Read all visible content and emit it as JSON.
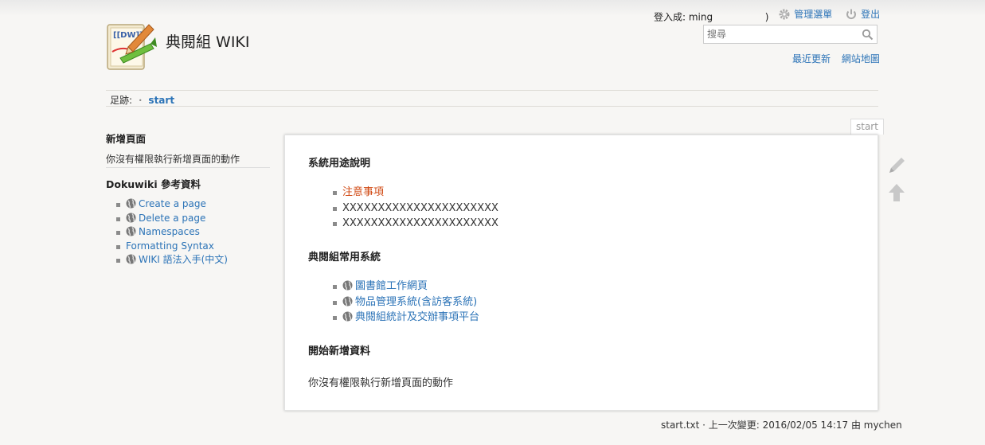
{
  "header": {
    "wiki_title": "典閱組 WIKI",
    "logo_text": "[[DW]]",
    "user_tools": {
      "logged_in_as": "登入成: ming",
      "logged_in_close": ")",
      "admin_menu": "管理選單",
      "logout": "登出"
    },
    "search": {
      "placeholder": "搜尋"
    },
    "site_tools": {
      "recent_changes": "最近更新",
      "sitemap": "網站地圖"
    }
  },
  "breadcrumb": {
    "label": "足跡:",
    "items": [
      "start"
    ]
  },
  "sidebar": {
    "heading_new_page": "新增頁面",
    "no_permission": "你沒有權限執行新增頁面的動作",
    "heading_reference": "Dokuwiki 參考資料",
    "links": [
      {
        "label": "Create a page",
        "external": true
      },
      {
        "label": "Delete a page",
        "external": true
      },
      {
        "label": "Namespaces",
        "external": true
      },
      {
        "label": "Formatting Syntax",
        "external": false
      },
      {
        "label": "WIKI 語法入手(中文)",
        "external": true
      }
    ]
  },
  "page_tab": "start",
  "content": {
    "section1": {
      "heading": "系統用途說明",
      "items": [
        "注意事項",
        "XXXXXXXXXXXXXXXXXXXXXX",
        "XXXXXXXXXXXXXXXXXXXXXX"
      ]
    },
    "section2": {
      "heading": "典閱組常用系統",
      "items": [
        "圖書館工作網頁",
        "物品管理系統(含訪客系統)",
        "典閱組統計及交辦事項平台"
      ]
    },
    "section3": {
      "heading": "開始新增資料",
      "text": "你沒有權限執行新增頁面的動作"
    }
  },
  "footer": {
    "doc_info": "start.txt · 上一次變更: 2016/02/05 14:17 由 mychen"
  },
  "colors": {
    "link": "#2b73b7",
    "warning_link": "#d04812",
    "background": "#f7f6f4"
  }
}
